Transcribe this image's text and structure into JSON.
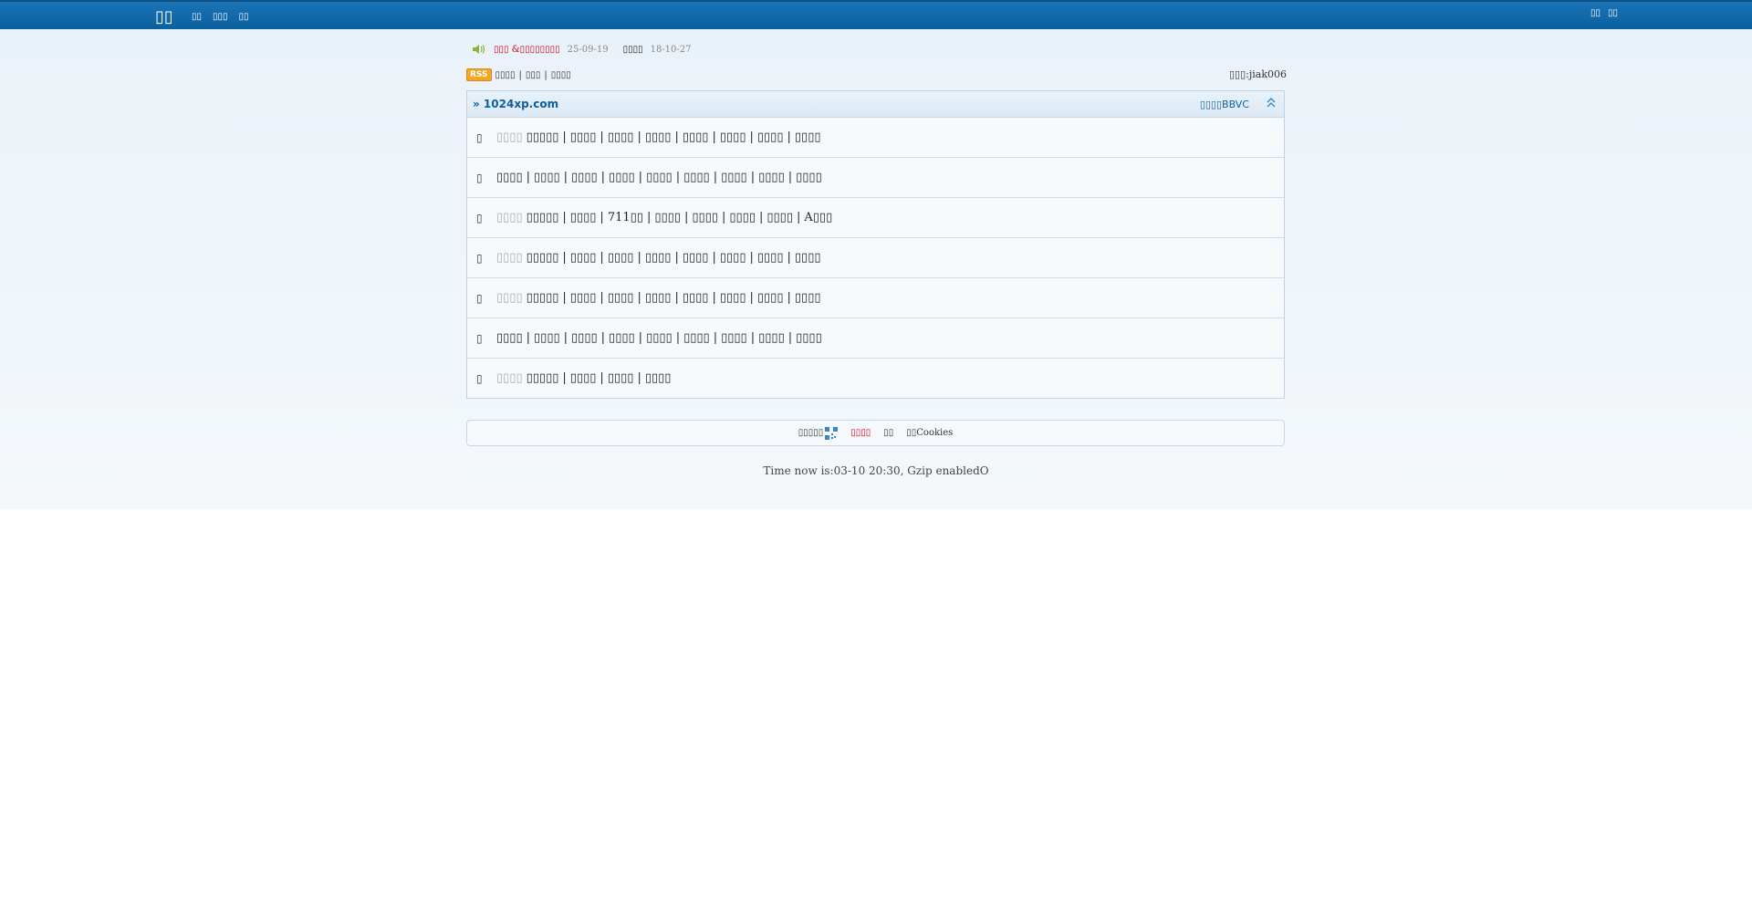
{
  "header": {
    "logo": "▯▯",
    "nav": [
      "▯▯",
      "▯▯▯",
      "▯▯"
    ],
    "right_links": [
      "▯▯",
      "▯▯"
    ]
  },
  "notice": {
    "title": "▯▯▯ &▯▯▯▯▯▯▯▯",
    "date": "25-09-19",
    "second_title": "▯▯▯▯",
    "second_date": "18-10-27"
  },
  "rss": {
    "badge": "RSS",
    "links": [
      "▯▯▯▯",
      "▯▯▯",
      "▯▯▯▯"
    ],
    "moderator": "▯▯▯:jiak006"
  },
  "forum": {
    "title": "» 1024xp.com",
    "right_text": "▯▯▯▯BBVC",
    "rows": [
      {
        "icon": "▯",
        "first": "▯▯▯▯",
        "items": [
          "▯▯▯▯▯",
          "▯▯▯▯",
          "▯▯▯▯",
          "▯▯▯▯",
          "▯▯▯▯",
          "▯▯▯▯",
          "▯▯▯▯",
          "▯▯▯▯"
        ]
      },
      {
        "icon": "▯",
        "first": "",
        "items": [
          "▯▯▯▯",
          "▯▯▯▯",
          "▯▯▯▯",
          "▯▯▯▯",
          "▯▯▯▯",
          "▯▯▯▯",
          "▯▯▯▯",
          "▯▯▯▯",
          "▯▯▯▯"
        ]
      },
      {
        "icon": "▯",
        "first": "▯▯▯▯",
        "items": [
          "▯▯▯▯▯",
          "▯▯▯▯",
          "711▯▯",
          "▯▯▯▯",
          "▯▯▯▯",
          "▯▯▯▯",
          "▯▯▯▯",
          "A▯▯▯"
        ]
      },
      {
        "icon": "▯",
        "first": "▯▯▯▯",
        "items": [
          "▯▯▯▯▯",
          "▯▯▯▯",
          "▯▯▯▯",
          "▯▯▯▯",
          "▯▯▯▯",
          "▯▯▯▯",
          "▯▯▯▯",
          "▯▯▯▯"
        ]
      },
      {
        "icon": "▯",
        "first": "▯▯▯▯",
        "items": [
          "▯▯▯▯▯",
          "▯▯▯▯",
          "▯▯▯▯",
          "▯▯▯▯",
          "▯▯▯▯",
          "▯▯▯▯",
          "▯▯▯▯",
          "▯▯▯▯"
        ]
      },
      {
        "icon": "▯",
        "first": "",
        "items": [
          "▯▯▯▯",
          "▯▯▯▯",
          "▯▯▯▯",
          "▯▯▯▯",
          "▯▯▯▯",
          "▯▯▯▯",
          "▯▯▯▯",
          "▯▯▯▯",
          "▯▯▯▯"
        ]
      },
      {
        "icon": "▯",
        "first": "▯▯▯▯",
        "items": [
          "▯▯▯▯▯",
          "▯▯▯▯",
          "▯▯▯▯",
          "▯▯▯▯"
        ]
      }
    ]
  },
  "footer": {
    "qr_label": "▯▯▯▯▯",
    "red_link": "▯▯▯▯",
    "link2": "▯▯",
    "link3": "▯▯Cookies"
  },
  "time_line": "Time now is:03-10 20:30, Gzip enabledO",
  "colors": {
    "topbar": "#0b5f9e",
    "accent": "#0b5f9e",
    "notice_red": "#d0021b",
    "rss": "#f5a623"
  }
}
